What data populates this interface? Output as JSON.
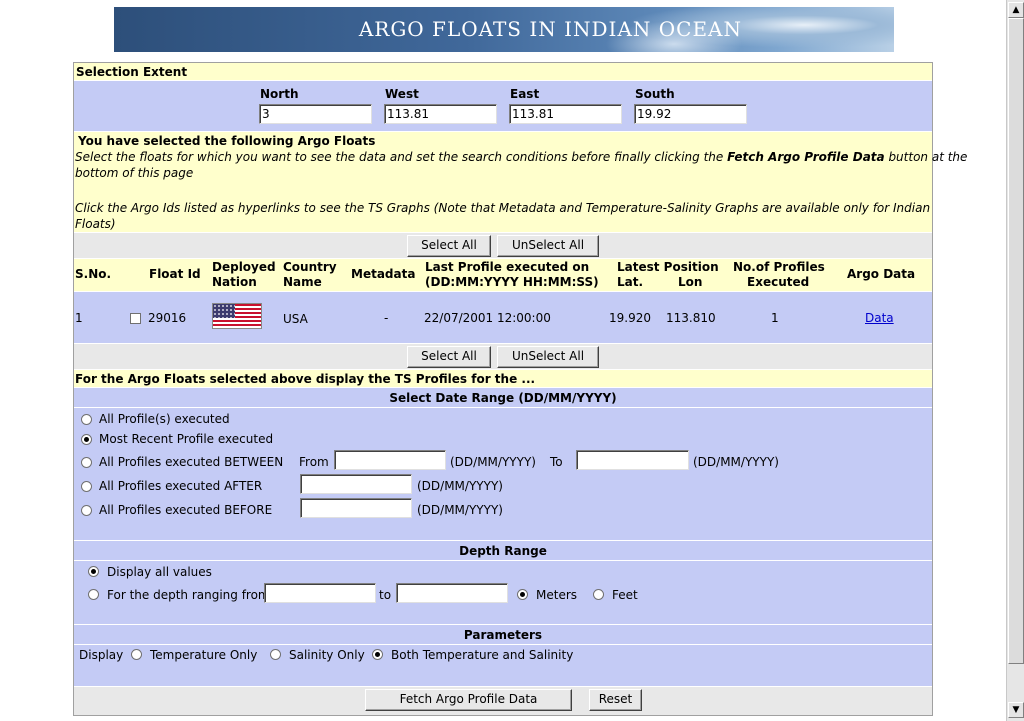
{
  "banner": {
    "title": "ARGO FLOATS IN INDIAN OCEAN"
  },
  "selection_extent": {
    "heading": "Selection Extent",
    "north_label": "North",
    "north_value": "3",
    "west_label": "West",
    "west_value": "113.81",
    "east_label": "East",
    "east_value": "113.81",
    "south_label": "South",
    "south_value": "19.92"
  },
  "selected_info": {
    "heading": "You have selected the following Argo Floats",
    "line1_a": "Select the floats for which you want to see the data and set the search conditions before finally clicking the ",
    "line1_bold": "Fetch Argo Profile Data",
    "line1_b": " button at the",
    "line2": "bottom of this page",
    "line3": "Click the Argo Ids listed as hyperlinks to see the TS Graphs (Note that Metadata and Temperature-Salinity Graphs are available only for Indian",
    "line4": "Floats)"
  },
  "buttons": {
    "select_all": "Select All",
    "unselect_all": "UnSelect All",
    "fetch": "Fetch Argo Profile Data",
    "reset": "Reset"
  },
  "table": {
    "headers": {
      "sno": "S.No.",
      "float_id": "Float Id",
      "deployed_nation_1": "Deployed",
      "deployed_nation_2": "Nation",
      "country_name_1": "Country",
      "country_name_2": "Name",
      "metadata": "Metadata",
      "last_profile_1": "Last Profile executed on",
      "last_profile_2": "(DD:MM:YYYY HH:MM:SS)",
      "latest_position": "Latest Position",
      "lat": "Lat.",
      "lon": "Lon",
      "num_profiles_1": "No.of Profiles",
      "num_profiles_2": "Executed",
      "argo_data": "Argo Data"
    },
    "rows": [
      {
        "sno": "1",
        "float_id": "29016",
        "country": "USA",
        "metadata": "-",
        "last_profile": "22/07/2001 12:00:00",
        "lat": "19.920",
        "lon": "113.810",
        "num_profiles": "1",
        "data_link": "Data",
        "flag_icon": "usa-flag-icon"
      }
    ]
  },
  "ts_profiles": {
    "heading": "For the Argo Floats selected above display the TS Profiles for the ..."
  },
  "date_range": {
    "heading": "Select Date Range (DD/MM/YYYY)",
    "opt_all": "All Profile(s) executed",
    "opt_recent": "Most Recent Profile executed",
    "opt_between": "All Profiles executed BETWEEN",
    "from_label": "From",
    "fmt": "(DD/MM/YYYY)",
    "to_label": "To",
    "opt_after": "All Profiles executed AFTER",
    "opt_before": "All Profiles executed BEFORE",
    "selected": "recent"
  },
  "depth_range": {
    "heading": "Depth Range",
    "opt_all": "Display all values",
    "opt_range": "For the depth ranging from",
    "to_label": "to",
    "meters": "Meters",
    "feet": "Feet",
    "selected": "all",
    "unit": "meters"
  },
  "parameters": {
    "heading": "Parameters",
    "display_label": "Display",
    "opt_temp": "Temperature Only",
    "opt_sal": "Salinity Only",
    "opt_both": "Both Temperature and Salinity",
    "selected": "both"
  },
  "colors": {
    "yellow": "#ffffcc",
    "blue": "#c4cbf5",
    "grey": "#e8e8e8",
    "link": "#0000cc"
  }
}
